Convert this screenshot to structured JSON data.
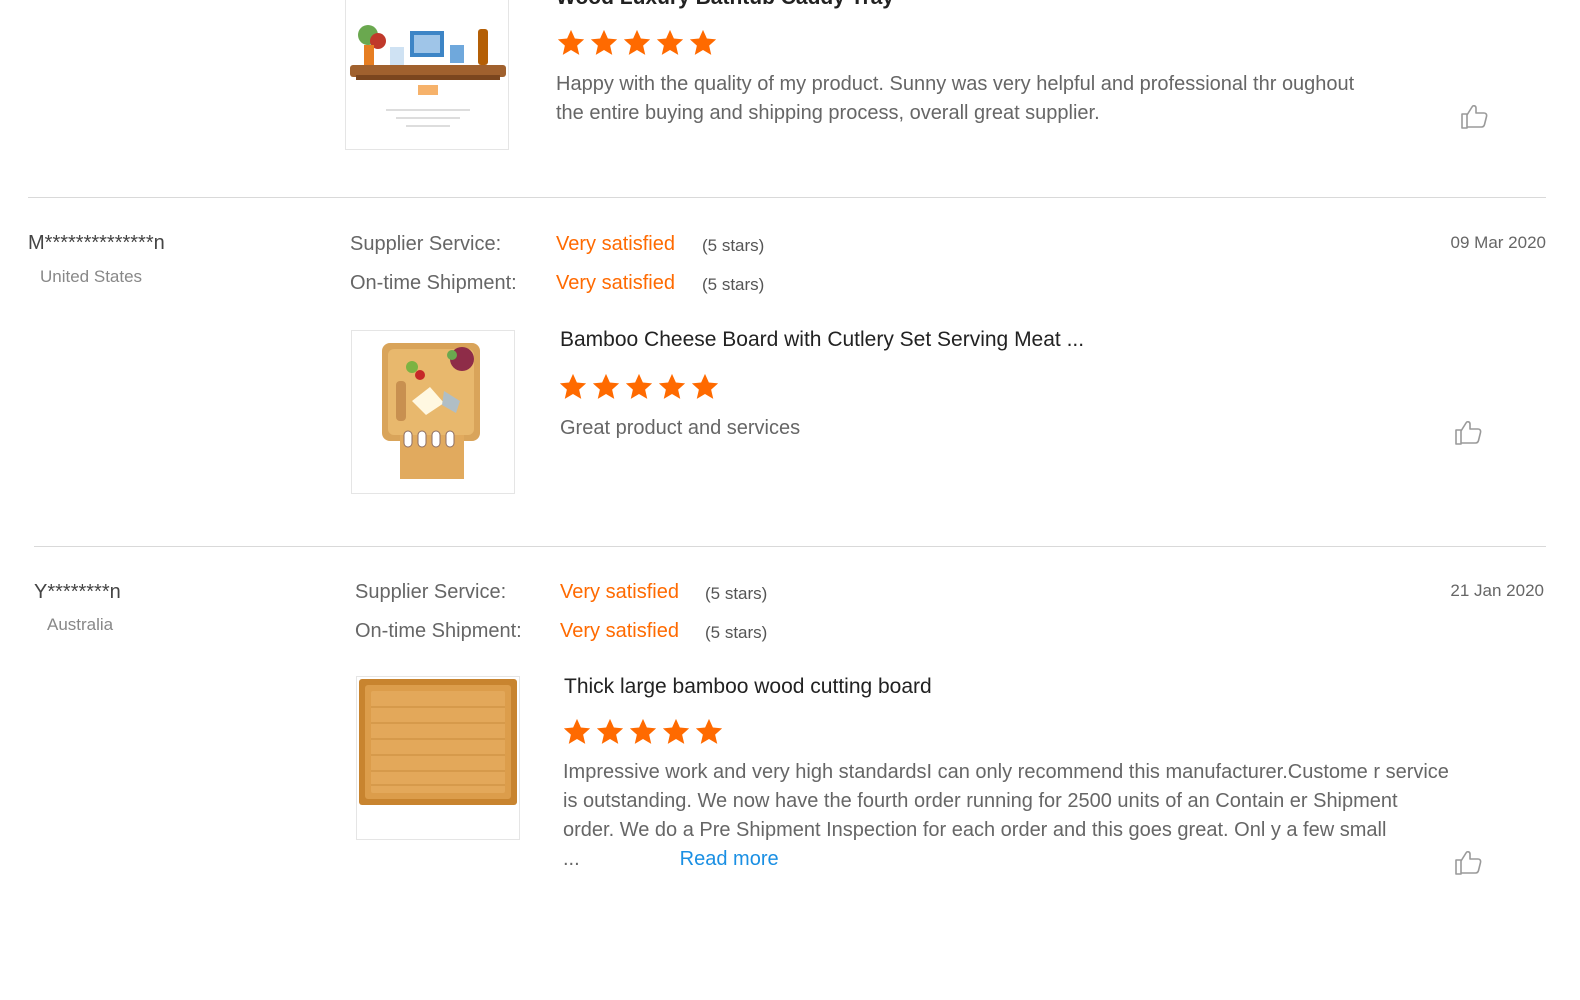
{
  "reviews": [
    {
      "reviewer": "",
      "country": "",
      "date": "",
      "product_title": "Wood Luxury Bathtub Caddy Tray",
      "product_stars": 5,
      "text": "Happy with the quality of my product. Sunny was very helpful and professional thr oughout the entire buying and shipping process, overall great supplier.",
      "read_more": ""
    },
    {
      "reviewer": "M**************n",
      "country": "United States",
      "supplier_service_label": "Supplier Service:",
      "supplier_service_value": "Very satisfied",
      "supplier_service_stars": "(5 stars)",
      "shipment_label": "On-time Shipment:",
      "shipment_value": "Very satisfied",
      "shipment_stars": "(5 stars)",
      "date": "09 Mar 2020",
      "product_title": "Bamboo Cheese Board with Cutlery Set Serving Meat ...",
      "product_stars": 5,
      "text": "Great product and services",
      "read_more": ""
    },
    {
      "reviewer": "Y********n",
      "country": "Australia",
      "supplier_service_label": "Supplier Service:",
      "supplier_service_value": "Very satisfied",
      "supplier_service_stars": "(5 stars)",
      "shipment_label": "On-time Shipment:",
      "shipment_value": "Very satisfied",
      "shipment_stars": "(5 stars)",
      "date": "21 Jan 2020",
      "product_title": "Thick large bamboo wood cutting board",
      "product_stars": 5,
      "text": "Impressive work and very high standardsI can only recommend this manufacturer.Custome r service is outstanding. We now have the fourth order running for 2500 units of an Contain er Shipment order. We do a Pre Shipment Inspection for each order and this goes great. Onl y a few small ...",
      "read_more": "Read more"
    }
  ],
  "colors": {
    "accent": "#ff6a00",
    "link": "#1a8fe3",
    "divider": "#d9d9d9"
  },
  "icons": {
    "like": "thumbs-up-icon",
    "star": "star-icon"
  }
}
